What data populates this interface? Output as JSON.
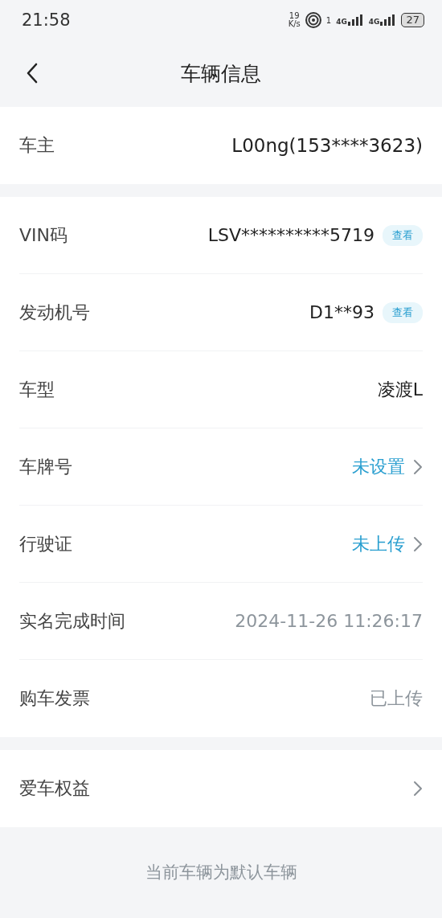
{
  "status_bar": {
    "time": "21:58",
    "speed_value": "19",
    "speed_unit": "K/s",
    "hotspot_count": "1",
    "network_1": "4G",
    "network_2": "4G",
    "battery": "27"
  },
  "header": {
    "title": "车辆信息"
  },
  "owner": {
    "label": "车主",
    "value": "L00ng(153****3623)"
  },
  "details": [
    {
      "kind": "reveal",
      "label": "VIN码",
      "value": "LSV**********5719",
      "action": "查看"
    },
    {
      "kind": "reveal",
      "label": "发动机号",
      "value": "D1**93",
      "action": "查看"
    },
    {
      "kind": "plain",
      "label": "车型",
      "value": "凌渡L"
    },
    {
      "kind": "link",
      "label": "车牌号",
      "value": "未设置"
    },
    {
      "kind": "link",
      "label": "行驶证",
      "value": "未上传"
    },
    {
      "kind": "muted",
      "label": "实名完成时间",
      "value": "2024-11-26 11:26:17"
    },
    {
      "kind": "muted",
      "label": "购车发票",
      "value": "已上传"
    }
  ],
  "benefits": {
    "label": "爱车权益"
  },
  "footer": {
    "note": "当前车辆为默认车辆"
  }
}
